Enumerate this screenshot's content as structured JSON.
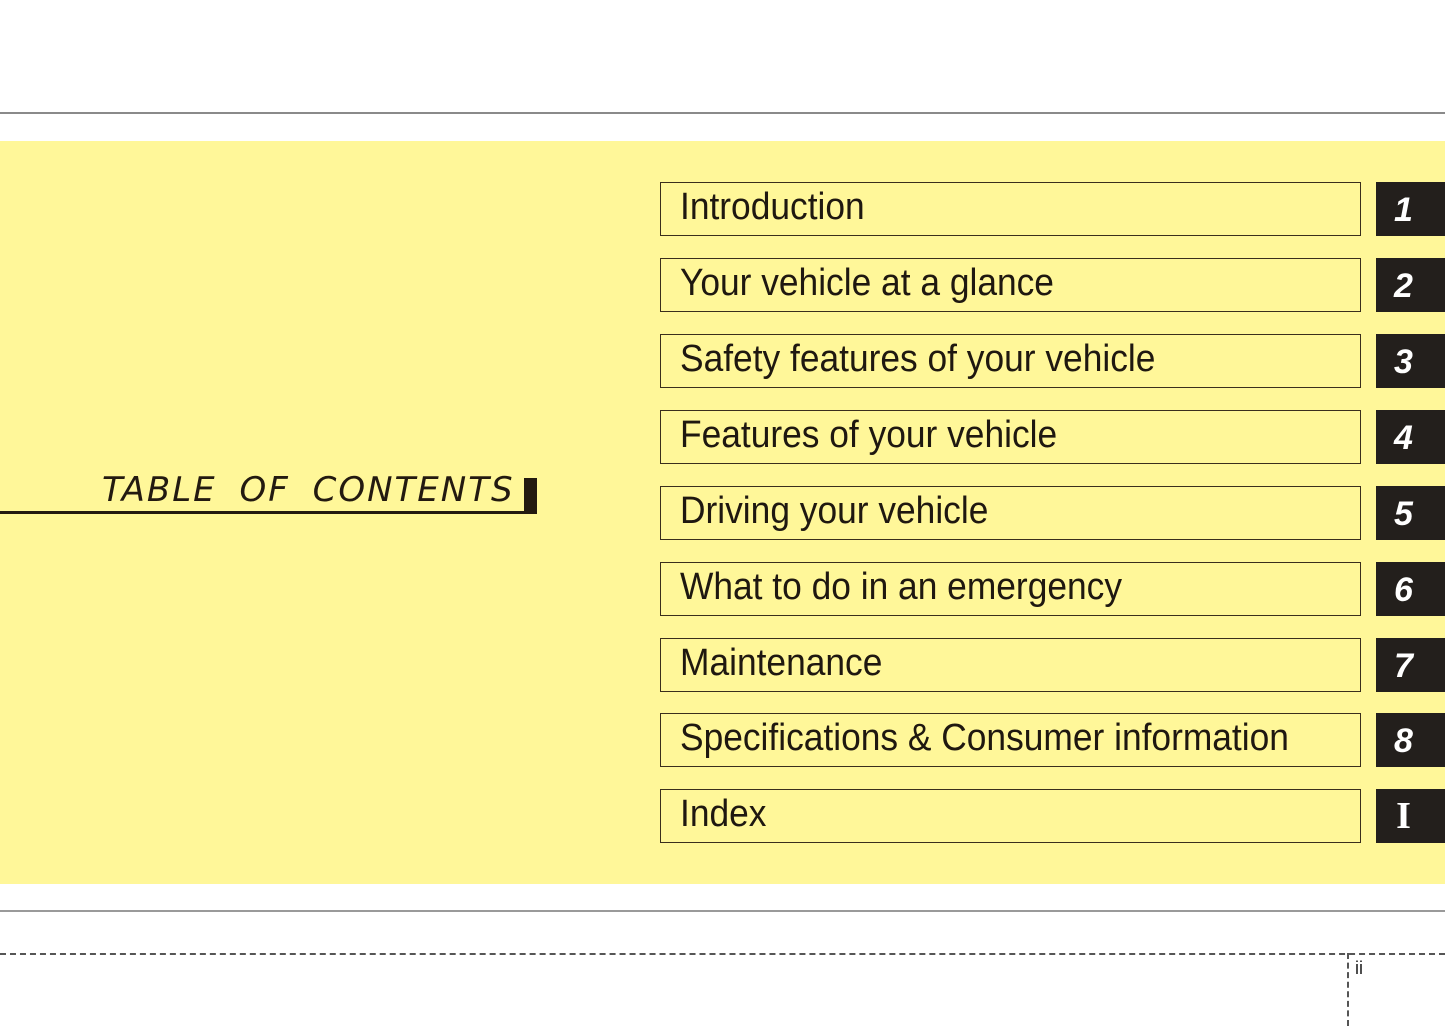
{
  "title": "TABLE OF CONTENTS",
  "page_number": "ii",
  "colors": {
    "band": "#fff799",
    "tab": "#231f1c",
    "text": "#1f1810"
  },
  "chapters": [
    {
      "label": "Introduction",
      "tab": "1"
    },
    {
      "label": "Your vehicle at a glance",
      "tab": "2"
    },
    {
      "label": "Safety features of your vehicle",
      "tab": "3"
    },
    {
      "label": "Features of your vehicle",
      "tab": "4"
    },
    {
      "label": "Driving your vehicle",
      "tab": "5"
    },
    {
      "label": "What to do in an emergency",
      "tab": "6"
    },
    {
      "label": "Maintenance",
      "tab": "7"
    },
    {
      "label": "Specifications & Consumer information",
      "tab": "8"
    },
    {
      "label": "Index",
      "tab": "I"
    }
  ]
}
